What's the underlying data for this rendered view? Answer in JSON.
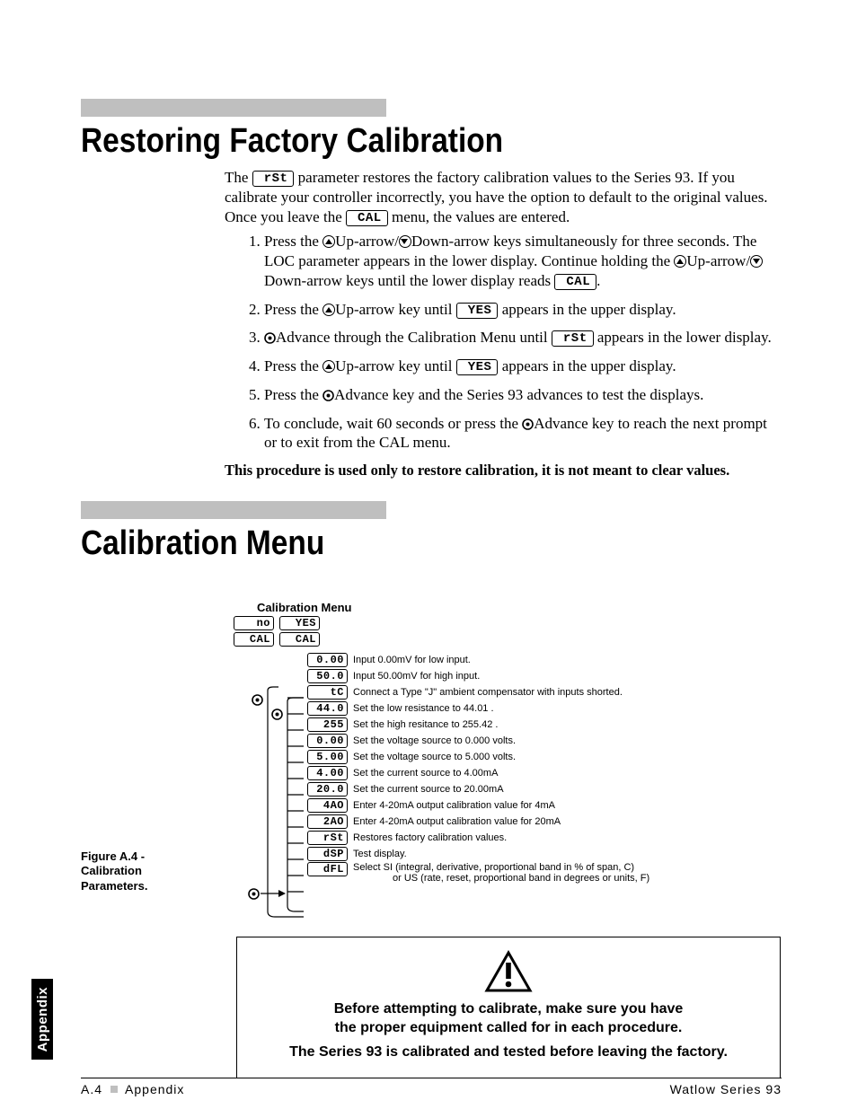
{
  "title1": "Restoring Factory Calibration",
  "intro": {
    "p1a": "The ",
    "p1_rst": "rSt",
    "p1b": " parameter restores the factory calibration values to the Series 93. If you calibrate your controller incorrectly, you have the option to default to the original values. Once you leave the ",
    "p1_cal": "CAL",
    "p1c": " menu, the values are entered."
  },
  "steps": {
    "s1a": "Press the ",
    "s1b": "Up-arrow/",
    "s1c": "Down-arrow keys simultaneously for three seconds. The LOC parameter appears in the lower display. Continue holding the ",
    "s1d": "Up-arrow/",
    "s1e": "Down-arrow keys until the lower display reads ",
    "s1_cal": "CAL",
    "s1f": ".",
    "s2a": "Press the ",
    "s2b": "Up-arrow key until ",
    "s2_yes": "YES",
    "s2c": " appears in the upper display.",
    "s3a": "Advance through the Calibration Menu until ",
    "s3_rst": "rSt",
    "s3b": " appears in the lower display.",
    "s4a": "Press the ",
    "s4b": "Up-arrow key until ",
    "s4_yes": "YES",
    "s4c": " appears in the upper display.",
    "s5a": "Press the ",
    "s5b": "Advance key and the Series 93 advances to test the displays.",
    "s6a": "To conclude, wait 60 seconds or press the ",
    "s6b": "Advance key to reach the next prompt or to exit from the CAL menu."
  },
  "bold_note": "This procedure is used only to restore calibration, it is not meant to clear values.",
  "title2": "Calibration Menu",
  "cal_menu_title": "Calibration Menu",
  "cal_top": {
    "no": "no",
    "yes": "YES",
    "cal1": "CAL",
    "cal2": "CAL"
  },
  "cal_rows": [
    {
      "lcd": "0.00",
      "desc": "Input 0.00mV for low input."
    },
    {
      "lcd": "50.0",
      "desc": "Input 50.00mV for high input."
    },
    {
      "lcd": "tC",
      "desc": "Connect a Type \"J\" ambient compensator with inputs shorted."
    },
    {
      "lcd": "44.0",
      "desc": "Set the low resistance to 44.01  ."
    },
    {
      "lcd": "255",
      "desc": "Set the high resitance to 255.42  ."
    },
    {
      "lcd": "0.00",
      "desc": "Set the voltage source to 0.000 volts."
    },
    {
      "lcd": "5.00",
      "desc": "Set the voltage source to 5.000 volts."
    },
    {
      "lcd": "4.00",
      "desc": "Set the current source to 4.00mA"
    },
    {
      "lcd": "20.0",
      "desc": "Set the current source to 20.00mA"
    },
    {
      "lcd": "4AO",
      "desc": "Enter 4-20mA output calibration value for 4mA"
    },
    {
      "lcd": "2AO",
      "desc": "Enter 4-20mA output calibration value for 20mA"
    },
    {
      "lcd": "rSt",
      "desc": "Restores factory calibration values."
    },
    {
      "lcd": "dSP",
      "desc": "Test display."
    },
    {
      "lcd": "dFL",
      "desc": "Select SI (integral, derivative, proportional band in % of span,  C)",
      "desc2": "or US (rate, reset, proportional band in degrees or units,  F)"
    }
  ],
  "fig_label": "Figure A.4 - Calibration Parameters.",
  "warn": {
    "l1": "Before attempting to calibrate, make sure you have",
    "l2": "the proper equipment called for in each procedure.",
    "l3": "The Series 93 is calibrated and tested before leaving the factory."
  },
  "sidetab": "Appendix",
  "footer": {
    "left_a": "A.4",
    "left_b": "Appendix",
    "right": "Watlow Series 93"
  }
}
